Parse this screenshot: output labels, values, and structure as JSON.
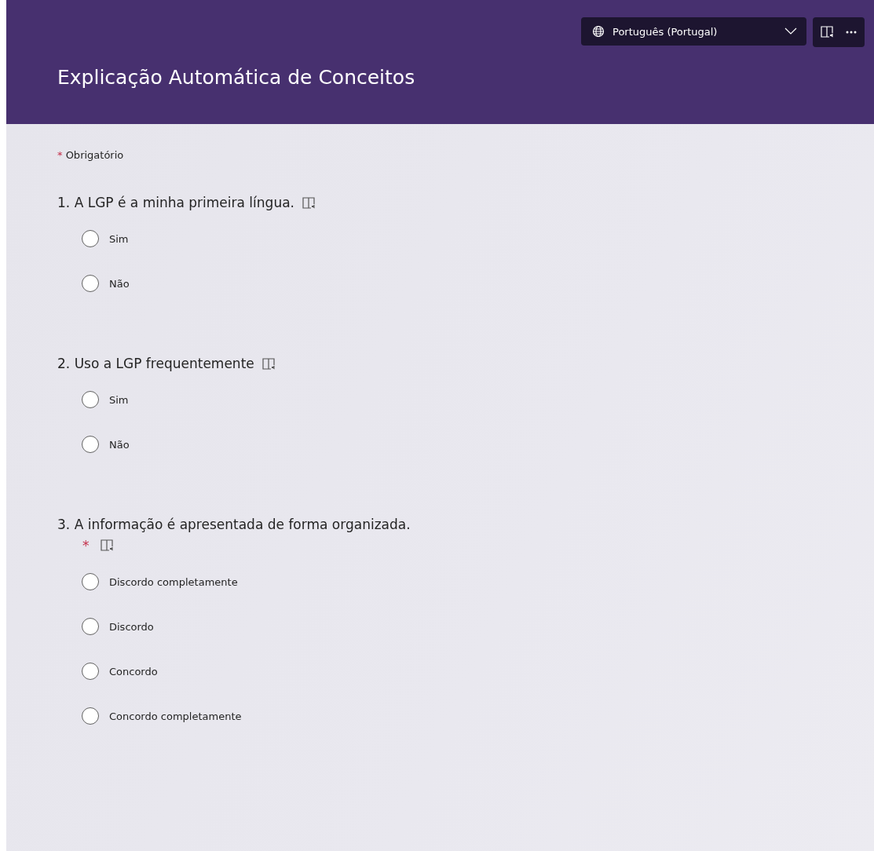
{
  "header": {
    "language": "Português (Portugal)",
    "title": "Explicação Automática de Conceitos"
  },
  "required_note": {
    "mark": "*",
    "label": "Obrigatório"
  },
  "questions": [
    {
      "number": "1.",
      "text": "A LGP é a minha primeira língua.",
      "required": false,
      "options": [
        {
          "label": "Sim",
          "selected": false
        },
        {
          "label": "Não",
          "selected": false
        }
      ]
    },
    {
      "number": "2.",
      "text": "Uso a LGP frequentemente",
      "required": false,
      "options": [
        {
          "label": "Sim",
          "selected": false
        },
        {
          "label": "Não",
          "selected": false
        }
      ]
    },
    {
      "number": "3.",
      "text": "A informação é apresentada de forma organizada.",
      "required": true,
      "options": [
        {
          "label": "Discordo completamente",
          "selected": false
        },
        {
          "label": "Discordo",
          "selected": false
        },
        {
          "label": "Concordo",
          "selected": false
        },
        {
          "label": "Concordo completamente",
          "selected": false
        }
      ]
    }
  ]
}
